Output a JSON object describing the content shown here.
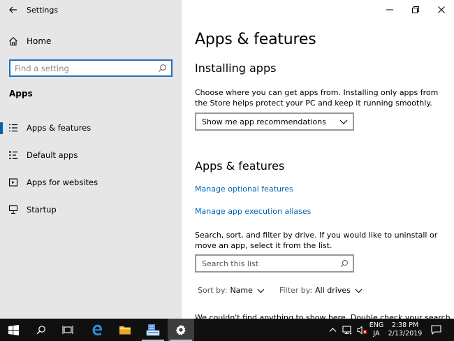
{
  "window": {
    "title": "Settings"
  },
  "sidebar": {
    "home_label": "Home",
    "search_placeholder": "Find a setting",
    "section_title": "Apps",
    "items": [
      {
        "label": "Apps & features",
        "icon": "list-icon",
        "selected": true
      },
      {
        "label": "Default apps",
        "icon": "default-apps-icon",
        "selected": false
      },
      {
        "label": "Apps for websites",
        "icon": "web-app-icon",
        "selected": false
      },
      {
        "label": "Startup",
        "icon": "startup-icon",
        "selected": false
      }
    ]
  },
  "main": {
    "page_title": "Apps & features",
    "installing": {
      "heading": "Installing apps",
      "description": "Choose where you can get apps from. Installing only apps from the Store helps protect your PC and keep it running smoothly.",
      "dropdown_value": "Show me app recommendations"
    },
    "features": {
      "heading": "Apps & features",
      "link_optional": "Manage optional features",
      "link_aliases": "Manage app execution aliases",
      "description": "Search, sort, and filter by drive. If you would like to uninstall or move an app, select it from the list.",
      "search_placeholder": "Search this list",
      "sort_label": "Sort by:",
      "sort_value": "Name",
      "filter_label": "Filter by:",
      "filter_value": "All drives",
      "cut_text": "We couldn't find anything to show here. Double check your search"
    }
  },
  "taskbar": {
    "language_top": "ENG",
    "language_bottom": "JA",
    "time": "2:38 PM",
    "date": "2/13/2019"
  },
  "colors": {
    "accent": "#0063b1",
    "sidebar_bg": "#e6e6e6",
    "taskbar_bg": "#101010"
  }
}
